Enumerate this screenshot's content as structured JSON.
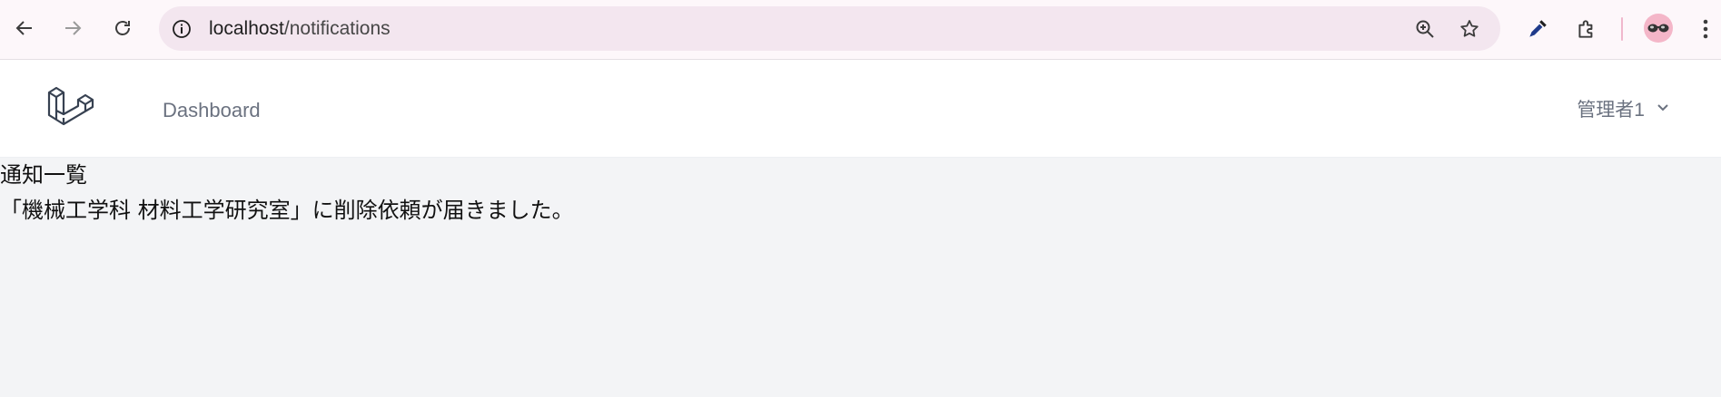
{
  "browser": {
    "url_host": "localhost",
    "url_path": "/notifications",
    "icons": [
      "back-icon",
      "forward-icon",
      "reload-icon",
      "site-info-icon",
      "zoom-icon",
      "bookmark-star-icon",
      "eyedropper-icon",
      "extensions-icon",
      "profile-avatar",
      "more-menu-icon"
    ]
  },
  "header": {
    "nav_link": "Dashboard",
    "user_name": "管理者1"
  },
  "main": {
    "title": "通知一覧",
    "notifications": [
      "「機械工学科 材料工学研究室」に削除依頼が届きました。"
    ]
  },
  "colors": {
    "chrome_bg": "#fdf7fa",
    "omnibox_bg": "#f3e6ef",
    "page_bg": "#f3f4f6",
    "nav_text": "#6b7280",
    "avatar_bg": "#f4b6c8"
  }
}
